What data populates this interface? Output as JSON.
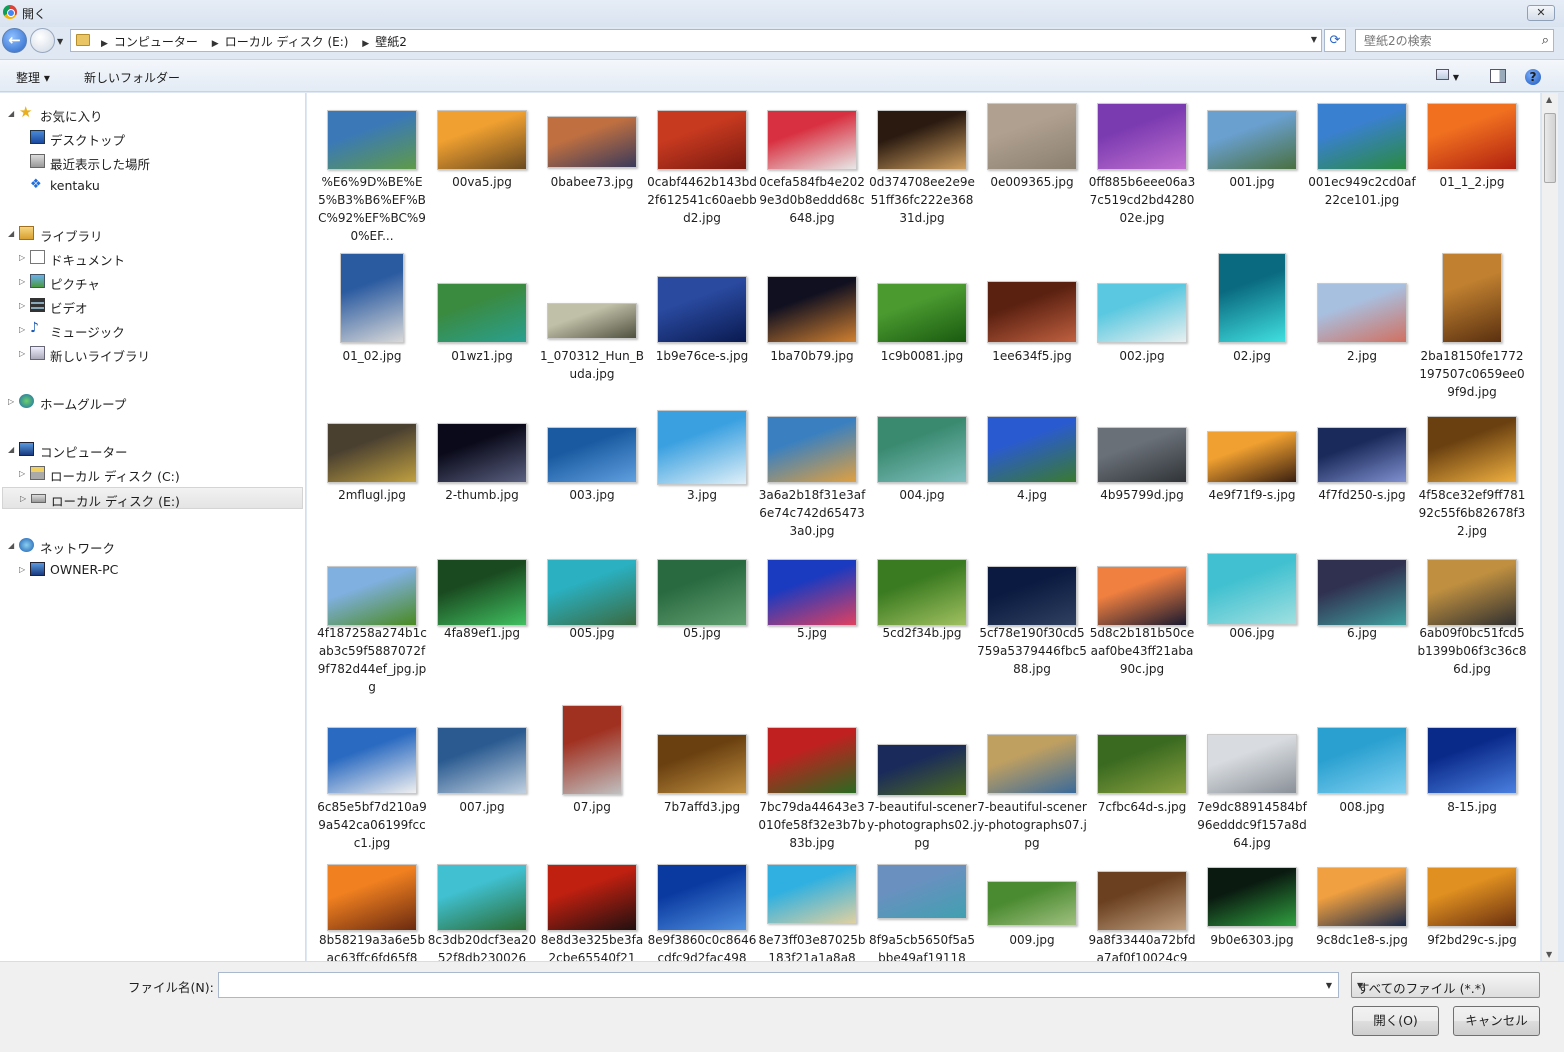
{
  "window": {
    "title": "開く",
    "close_label": "✕"
  },
  "address": {
    "crumbs": [
      "コンピューター",
      "ローカル ディスク (E:)",
      "壁紙2"
    ],
    "search_placeholder": "壁紙2の検索"
  },
  "toolbar": {
    "organize": "整理 ▾",
    "new_folder": "新しいフォルダー"
  },
  "nav": {
    "favorites": "お気に入り",
    "desktop": "デスクトップ",
    "recent": "最近表示した場所",
    "kentaku": "kentaku",
    "libraries": "ライブラリ",
    "documents": "ドキュメント",
    "pictures": "ピクチャ",
    "videos": "ビデオ",
    "music": "ミュージック",
    "new_library": "新しいライブラリ",
    "homegroup": "ホームグループ",
    "computer": "コンピューター",
    "disk_c": "ローカル ディスク (C:)",
    "disk_e": "ローカル ディスク (E:)",
    "network": "ネットワーク",
    "owner_pc": "OWNER-PC"
  },
  "files": [
    {
      "name": "%E6%9D%BE%E5%B3%B6%EF%BC%92%EF%BC%90%EF...",
      "c1": "#3a78b8",
      "c2": "#5f9a48"
    },
    {
      "name": "00va5.jpg",
      "c1": "#f0a030",
      "c2": "#6a4a20"
    },
    {
      "name": "0babee73.jpg",
      "c1": "#c07040",
      "c2": "#3a3a5a"
    },
    {
      "name": "0cabf4462b143bd2f612541c60aebbd2.jpg",
      "c1": "#c83a20",
      "c2": "#7a1a10"
    },
    {
      "name": "0cefa584fb4e2029e3d0b8eddd68c648.jpg",
      "c1": "#d83040",
      "c2": "#e8e8e8"
    },
    {
      "name": "0d374708ee2e9e51ff36fc222e36831d.jpg",
      "c1": "#2a1a10",
      "c2": "#d0a060"
    },
    {
      "name": "0e009365.jpg",
      "c1": "#b0a090",
      "c2": "#8a8070"
    },
    {
      "name": "0ff885b6eee06a37c519cd2bd428002e.jpg",
      "c1": "#7a3ab0",
      "c2": "#c070d0"
    },
    {
      "name": "001.jpg",
      "c1": "#6aa0d0",
      "c2": "#4a7040"
    },
    {
      "name": "001ec949c2cd0af22ce101.jpg",
      "c1": "#3a80d0",
      "c2": "#2a8a40"
    },
    {
      "name": "01_1_2.jpg",
      "c1": "#f07020",
      "c2": "#b02010"
    },
    {
      "name": "01_02.jpg",
      "c1": "#2a5aa0",
      "c2": "#d8d8d8"
    },
    {
      "name": "01wz1.jpg",
      "c1": "#3a8a40",
      "c2": "#2aa090"
    },
    {
      "name": "1_070312_Hun_Buda.jpg",
      "c1": "#c0c0a8",
      "c2": "#505040"
    },
    {
      "name": "1b9e76ce-s.jpg",
      "c1": "#2a4aa0",
      "c2": "#0a1a50"
    },
    {
      "name": "1ba70b79.jpg",
      "c1": "#101020",
      "c2": "#d08030"
    },
    {
      "name": "1c9b0081.jpg",
      "c1": "#4a9a30",
      "c2": "#1a5a10"
    },
    {
      "name": "1ee634f5.jpg",
      "c1": "#5a2010",
      "c2": "#c06040"
    },
    {
      "name": "002.jpg",
      "c1": "#5ac8e0",
      "c2": "#e8f0f0"
    },
    {
      "name": "02.jpg",
      "c1": "#0a6a80",
      "c2": "#40e0e0"
    },
    {
      "name": "2.jpg",
      "c1": "#a8c0e0",
      "c2": "#d07060"
    },
    {
      "name": "2ba18150fe1772197507c0659ee09f9d.jpg",
      "c1": "#c08030",
      "c2": "#5a3010"
    },
    {
      "name": "2mflugl.jpg",
      "c1": "#4a4030",
      "c2": "#c0a040"
    },
    {
      "name": "2-thumb.jpg",
      "c1": "#0a0a1a",
      "c2": "#5a6080"
    },
    {
      "name": "003.jpg",
      "c1": "#1a5aa0",
      "c2": "#60a0e0"
    },
    {
      "name": "3.jpg",
      "c1": "#3aa0e0",
      "c2": "#e0f0f8"
    },
    {
      "name": "3a6a2b18f31e3af6e74c742d654733a0.jpg",
      "c1": "#3a80c0",
      "c2": "#e0a040"
    },
    {
      "name": "004.jpg",
      "c1": "#3a8a70",
      "c2": "#80c0c0"
    },
    {
      "name": "4.jpg",
      "c1": "#2a5ad0",
      "c2": "#3a7a30"
    },
    {
      "name": "4b95799d.jpg",
      "c1": "#6a7078",
      "c2": "#303438"
    },
    {
      "name": "4e9f71f9-s.jpg",
      "c1": "#f0a030",
      "c2": "#3a2010"
    },
    {
      "name": "4f7fd250-s.jpg",
      "c1": "#1a2a5a",
      "c2": "#8090d0"
    },
    {
      "name": "4f58ce32ef9ff78192c55f6b82678f32.jpg",
      "c1": "#6a4010",
      "c2": "#f0b040"
    },
    {
      "name": "4f187258a274b1cab3c59f5887072f9f782d44ef_jpg.jpg",
      "c1": "#80b0e0",
      "c2": "#4a8a20"
    },
    {
      "name": "4fa89ef1.jpg",
      "c1": "#1a4a20",
      "c2": "#40c060"
    },
    {
      "name": "005.jpg",
      "c1": "#2ab0c0",
      "c2": "#3a6a40"
    },
    {
      "name": "05.jpg",
      "c1": "#2a6a40",
      "c2": "#60a070"
    },
    {
      "name": "5.jpg",
      "c1": "#1a3ac0",
      "c2": "#e04060"
    },
    {
      "name": "5cd2f34b.jpg",
      "c1": "#3a7a20",
      "c2": "#a0c060"
    },
    {
      "name": "5cf78e190f30cd5759a5379446fbc588.jpg",
      "c1": "#0a1a40",
      "c2": "#304060"
    },
    {
      "name": "5d8c2b181b50ceaaf0be43ff21aba90c.jpg",
      "c1": "#f08040",
      "c2": "#1a1a30"
    },
    {
      "name": "006.jpg",
      "c1": "#40c0d0",
      "c2": "#a0e0e0"
    },
    {
      "name": "6.jpg",
      "c1": "#303050",
      "c2": "#40a0a0"
    },
    {
      "name": "6ab09f0bc51fcd5b1399b06f3c36c86d.jpg",
      "c1": "#c09040",
      "c2": "#303030"
    },
    {
      "name": "6c85e5bf7d210a99a542ca06199fccc1.jpg",
      "c1": "#2a6ac0",
      "c2": "#f0f0f0"
    },
    {
      "name": "007.jpg",
      "c1": "#2a5a90",
      "c2": "#c0d0e0"
    },
    {
      "name": "07.jpg",
      "c1": "#a03020",
      "c2": "#c0c0c0"
    },
    {
      "name": "7b7affd3.jpg",
      "c1": "#6a4010",
      "c2": "#c09040"
    },
    {
      "name": "7bc79da44643e3010fe58f32e3b7b83b.jpg",
      "c1": "#c02020",
      "c2": "#2a6a20"
    },
    {
      "name": "7-beautiful-scenery-photographs02.jpg",
      "c1": "#1a2a5a",
      "c2": "#4a6a20"
    },
    {
      "name": "7-beautiful-scenery-photographs07.jpg",
      "c1": "#c0a060",
      "c2": "#3a6a9a"
    },
    {
      "name": "7cfbc64d-s.jpg",
      "c1": "#3a6a20",
      "c2": "#8aa040"
    },
    {
      "name": "7e9dc88914584bf96edddc9f157a8d64.jpg",
      "c1": "#d8dce0",
      "c2": "#8a9098"
    },
    {
      "name": "008.jpg",
      "c1": "#2aa0d0",
      "c2": "#80d0f0"
    },
    {
      "name": "8-15.jpg",
      "c1": "#0a2a8a",
      "c2": "#4a80e0"
    },
    {
      "name": "8b58219a3a6e5bac63ffc6fd65f8",
      "c1": "#f08020",
      "c2": "#6a2a10"
    },
    {
      "name": "8c3db20dcf3ea2052f8db230026",
      "c1": "#40c0d0",
      "c2": "#2a6a30"
    },
    {
      "name": "8e8d3e325be3fa2cbe65540f21",
      "c1": "#c02010",
      "c2": "#201010"
    },
    {
      "name": "8e9f3860c0c8646cdfc9d2fac498",
      "c1": "#0a3aa0",
      "c2": "#5090e0"
    },
    {
      "name": "8e73ff03e87025b183f21a1a8a8",
      "c1": "#30b0e0",
      "c2": "#e0d0a0"
    },
    {
      "name": "8f9a5cb5650f5a5bbe49af19118",
      "c1": "#6a90c0",
      "c2": "#40a0b0"
    },
    {
      "name": "009.jpg",
      "c1": "#4a8a30",
      "c2": "#a0c080"
    },
    {
      "name": "9a8f33440a72bfda7af0f10024c9",
      "c1": "#6a4020",
      "c2": "#c0a080"
    },
    {
      "name": "9b0e6303.jpg",
      "c1": "#0a1a10",
      "c2": "#30a040"
    },
    {
      "name": "9c8dc1e8-s.jpg",
      "c1": "#f0a040",
      "c2": "#1a2a4a"
    },
    {
      "name": "9f2bd29c-s.jpg",
      "c1": "#e09020",
      "c2": "#6a3010"
    }
  ],
  "bottom": {
    "filename_label": "ファイル名(N):",
    "filename_value": "",
    "filetype": "すべてのファイル (*.*)",
    "open_button": "開く(O)",
    "cancel_button": "キャンセル"
  }
}
